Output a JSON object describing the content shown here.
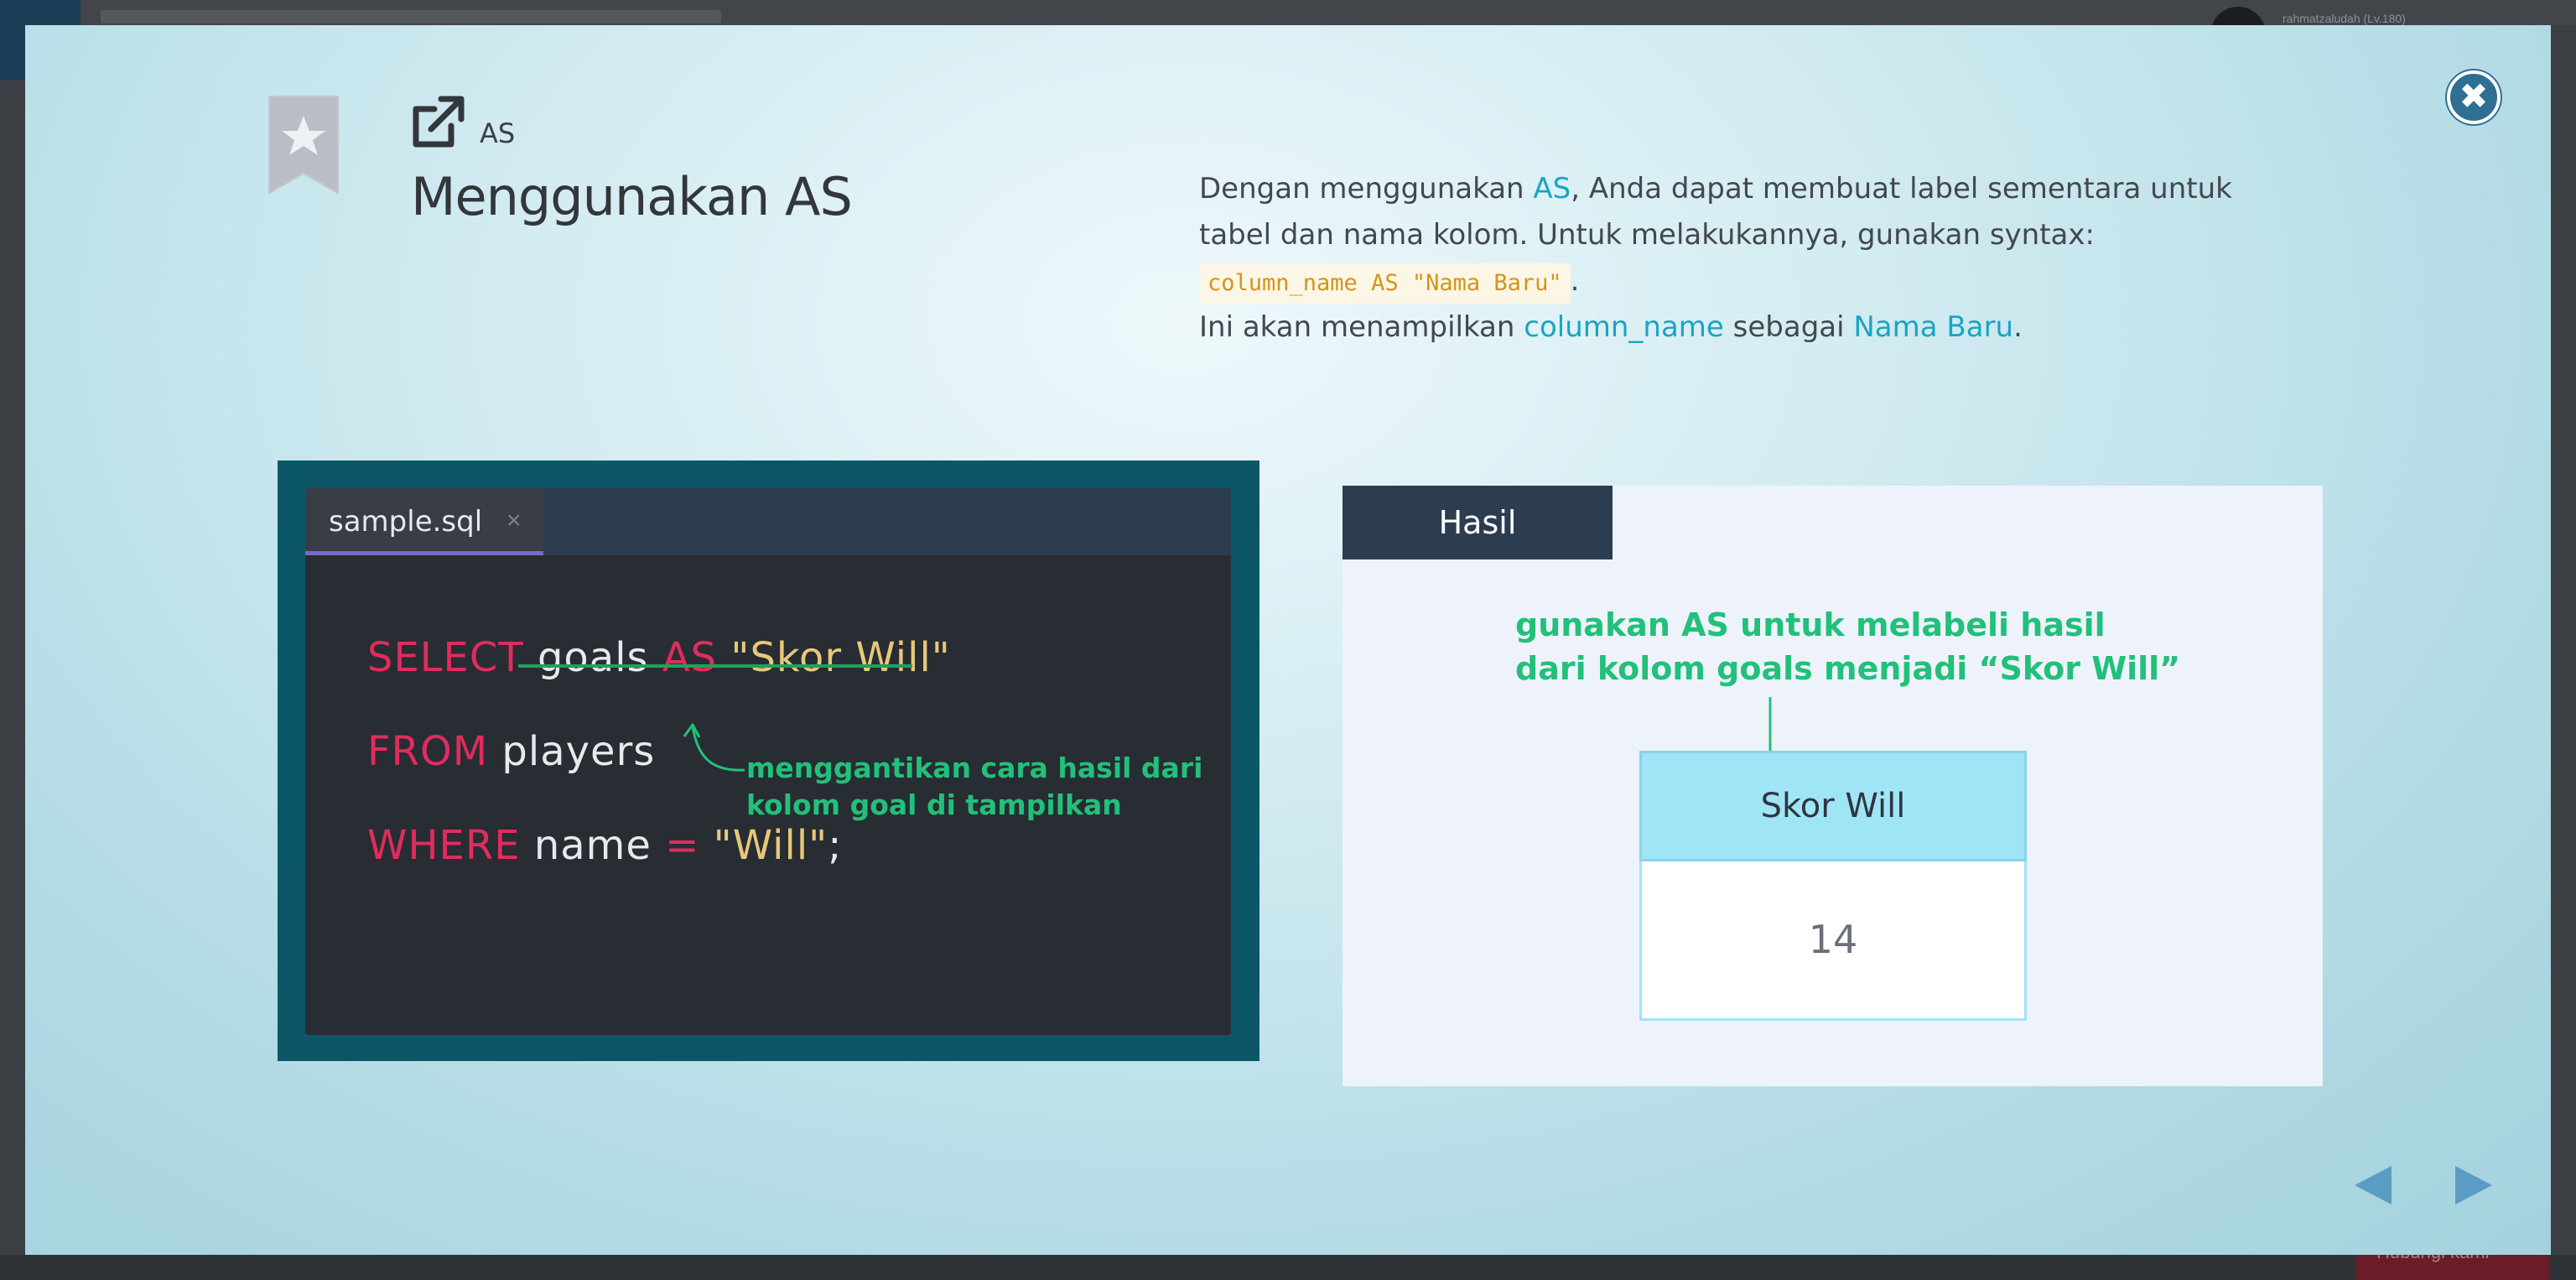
{
  "background": {
    "username": "rahmatzaludah (Lv.180)",
    "help_label": "Hubungi kami"
  },
  "modal": {
    "tag": "AS",
    "title": "Menggunakan AS",
    "description": {
      "p1_before": "Dengan menggunakan ",
      "p1_keyword": "AS",
      "p1_after": ", Anda dapat membuat label sementara untuk tabel dan nama kolom. Untuk melakukannya, gunakan syntax: ",
      "syntax": "column_name AS \"Nama Baru\"",
      "p1_end": ".",
      "p2_before": "Ini akan menampilkan ",
      "p2_column": "column_name",
      "p2_middle": " sebagai ",
      "p2_newname": "Nama Baru",
      "p2_end": "."
    },
    "editor": {
      "tab_name": "sample.sql",
      "tab_close": "×",
      "line1": {
        "kw1": "SELECT",
        "id1": " goals ",
        "kw2": "AS",
        "str": " \"Skor Will\""
      },
      "line2": {
        "kw1": "FROM",
        "id1": " players"
      },
      "line3": {
        "kw1": "WHERE",
        "id1": " name ",
        "op": "=",
        "str": " \"Will\"",
        "end": ";"
      },
      "annotation": "menggantikan cara hasil dari kolom goal di tampilkan"
    },
    "result": {
      "tab_label": "Hasil",
      "note": "gunakan AS untuk melabeli hasil dari kolom goals menjadi “Skor Will”",
      "column_header": "Skor Will",
      "cell_value": "14"
    },
    "colors": {
      "accent": "#1aa4c5",
      "close_button": "#2e6f93",
      "keyword": "#e02c5d",
      "string": "#e6c87a",
      "annotation": "#22c07a",
      "table_header": "#9fe5f6"
    },
    "icons": {
      "close": "close-icon",
      "bookmark": "bookmark-star-icon",
      "external_link": "external-link-icon",
      "prev": "prev-arrow-icon",
      "next": "next-arrow-icon"
    }
  }
}
